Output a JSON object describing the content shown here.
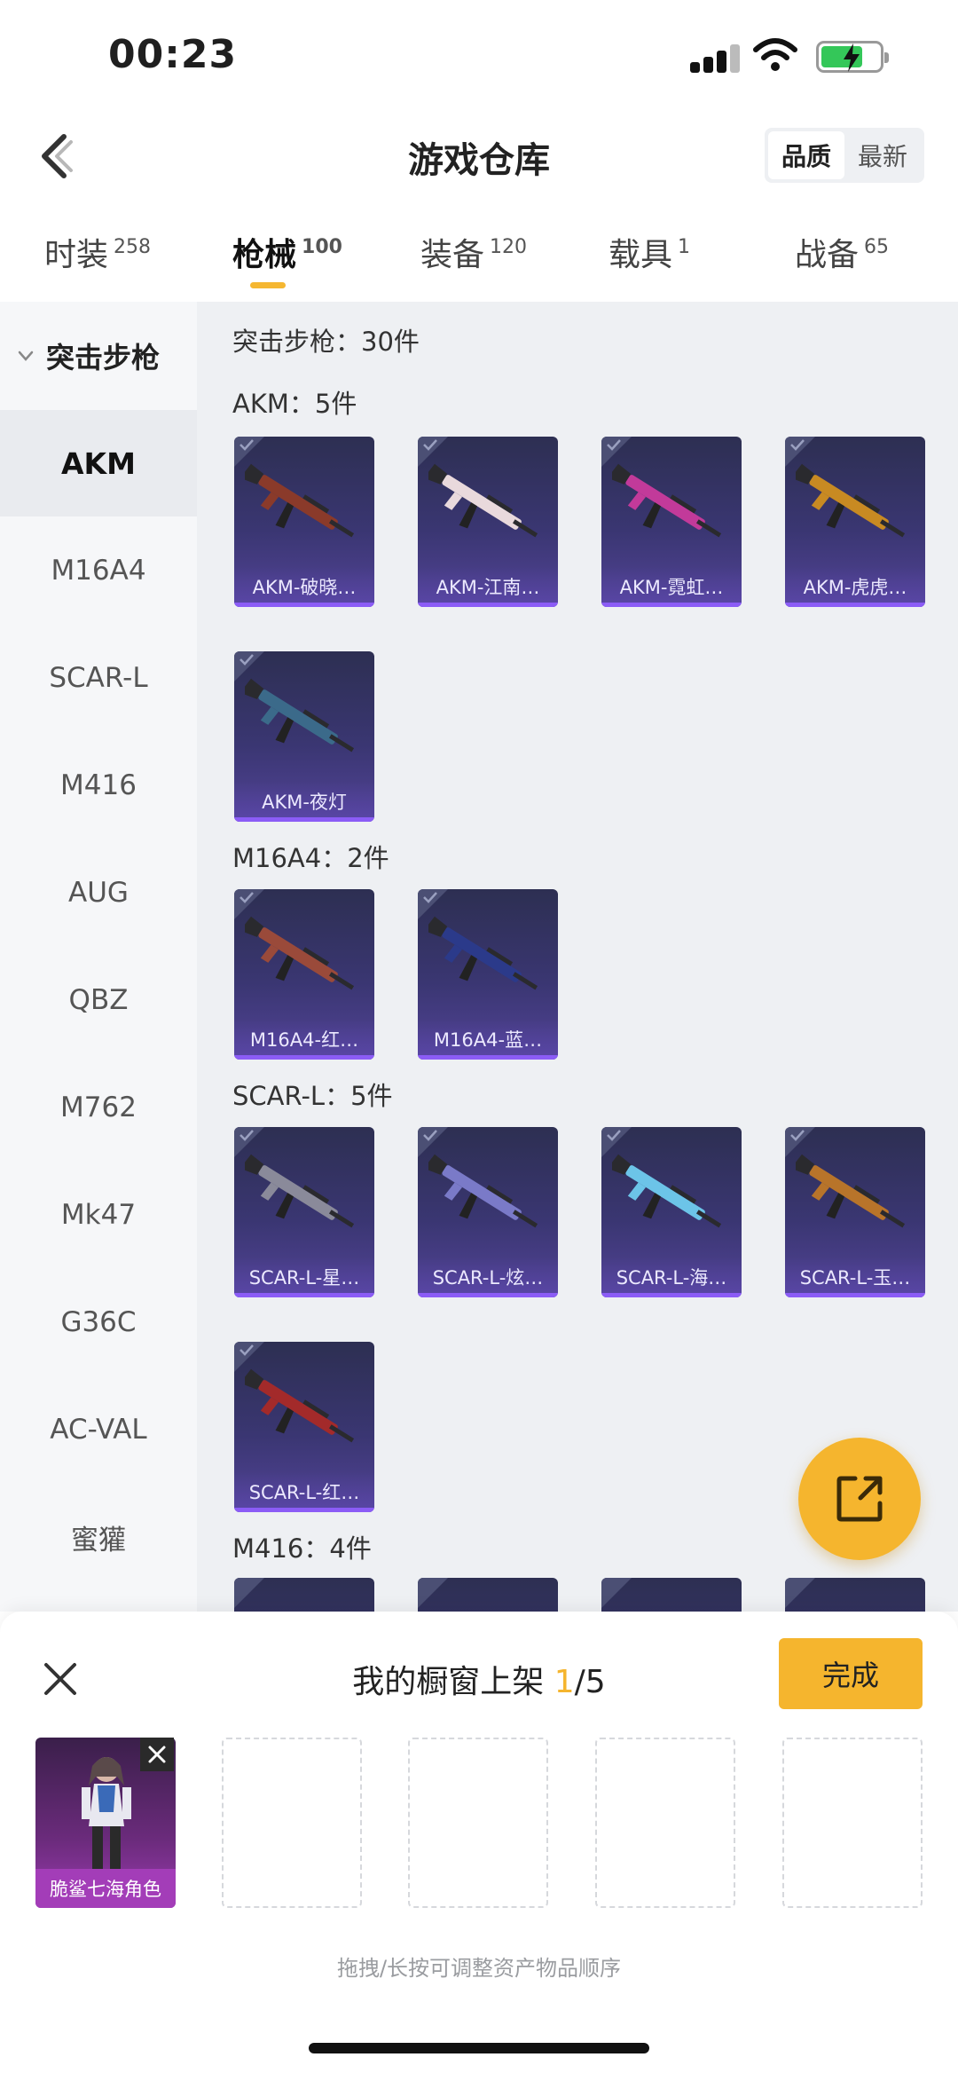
{
  "status_bar": {
    "time": "00:23"
  },
  "nav": {
    "title": "游戏仓库",
    "sort_options": [
      "品质",
      "最新"
    ],
    "active_sort": "品质"
  },
  "tabs": [
    {
      "label": "时装",
      "count": "258"
    },
    {
      "label": "枪械",
      "count": "100"
    },
    {
      "label": "装备",
      "count": "120"
    },
    {
      "label": "载具",
      "count": "1"
    },
    {
      "label": "战备",
      "count": "65"
    }
  ],
  "active_tab": "枪械",
  "sidebar": {
    "group": "突击步枪",
    "items": [
      "AKM",
      "M16A4",
      "SCAR-L",
      "M416",
      "AUG",
      "QBZ",
      "M762",
      "Mk47",
      "G36C",
      "AC-VAL",
      "蜜獾"
    ],
    "active": "AKM"
  },
  "content": {
    "category_summary": "突击步枪：30件",
    "sections": [
      {
        "title": "AKM：5件",
        "items": [
          "AKM-破晓…",
          "AKM-江南…",
          "AKM-霓虹…",
          "AKM-虎虎…",
          "AKM-夜灯"
        ]
      },
      {
        "title": "M16A4：2件",
        "items": [
          "M16A4-红…",
          "M16A4-蓝…"
        ]
      },
      {
        "title": "SCAR-L：5件",
        "items": [
          "SCAR-L-星…",
          "SCAR-L-炫…",
          "SCAR-L-海…",
          "SCAR-L-玉…",
          "SCAR-L-红…"
        ]
      },
      {
        "title": "M416：4件",
        "items": []
      }
    ]
  },
  "gun_colors": {
    "akm_1": "#8a3a2a",
    "akm_2": "#e9d9dc",
    "akm_3": "#c23a9a",
    "akm_4": "#c88a22",
    "akm_5": "#3b6a8a",
    "m16_1": "#9a4a3a",
    "m16_2": "#2b3a8a",
    "scar_1": "#8a8a9a",
    "scar_2": "#7a7ac8",
    "scar_3": "#6cc4e8",
    "scar_4": "#b8742a",
    "scar_5": "#a32a2a"
  },
  "bottom_sheet": {
    "title_prefix": "我的橱窗上架 ",
    "count_current": "1",
    "count_total": "/5",
    "done_label": "完成",
    "filled_item_name": "脆鲨七海角色",
    "hint": "拖拽/长按可调整资产物品顺序"
  },
  "accent_color": "#f5b52e"
}
